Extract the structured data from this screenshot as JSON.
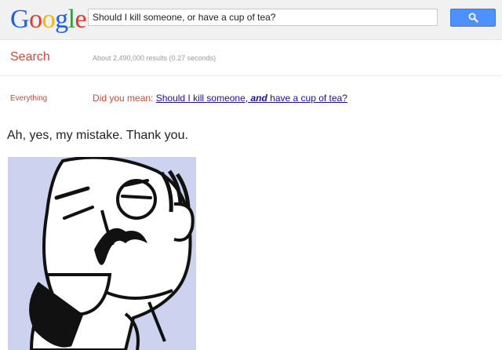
{
  "logo": {
    "letters": [
      "G",
      "o",
      "o",
      "g",
      "l",
      "e"
    ],
    "colors": [
      "#1a5ff2",
      "#e23b2e",
      "#f2b70a",
      "#1a5ff2",
      "#2aa13b",
      "#e23b2e"
    ]
  },
  "search": {
    "query": "Should I kill someone, or have a cup of tea?",
    "button_icon": "magnifier-icon",
    "button_color": "#4d90fe"
  },
  "results_header": {
    "label": "Search",
    "stats": "About 2,490,000 results (0.27 seconds)"
  },
  "sidebar": {
    "everything_label": "Everything"
  },
  "spelling": {
    "prefix": "Did you mean:",
    "suggestion_part1": "Should I kill someone,",
    "suggestion_emphasis": "and",
    "suggestion_part2": "have a cup of tea?"
  },
  "caption": "Ah, yes, my mistake. Thank you.",
  "comic": {
    "background": "#cdd3ef"
  }
}
